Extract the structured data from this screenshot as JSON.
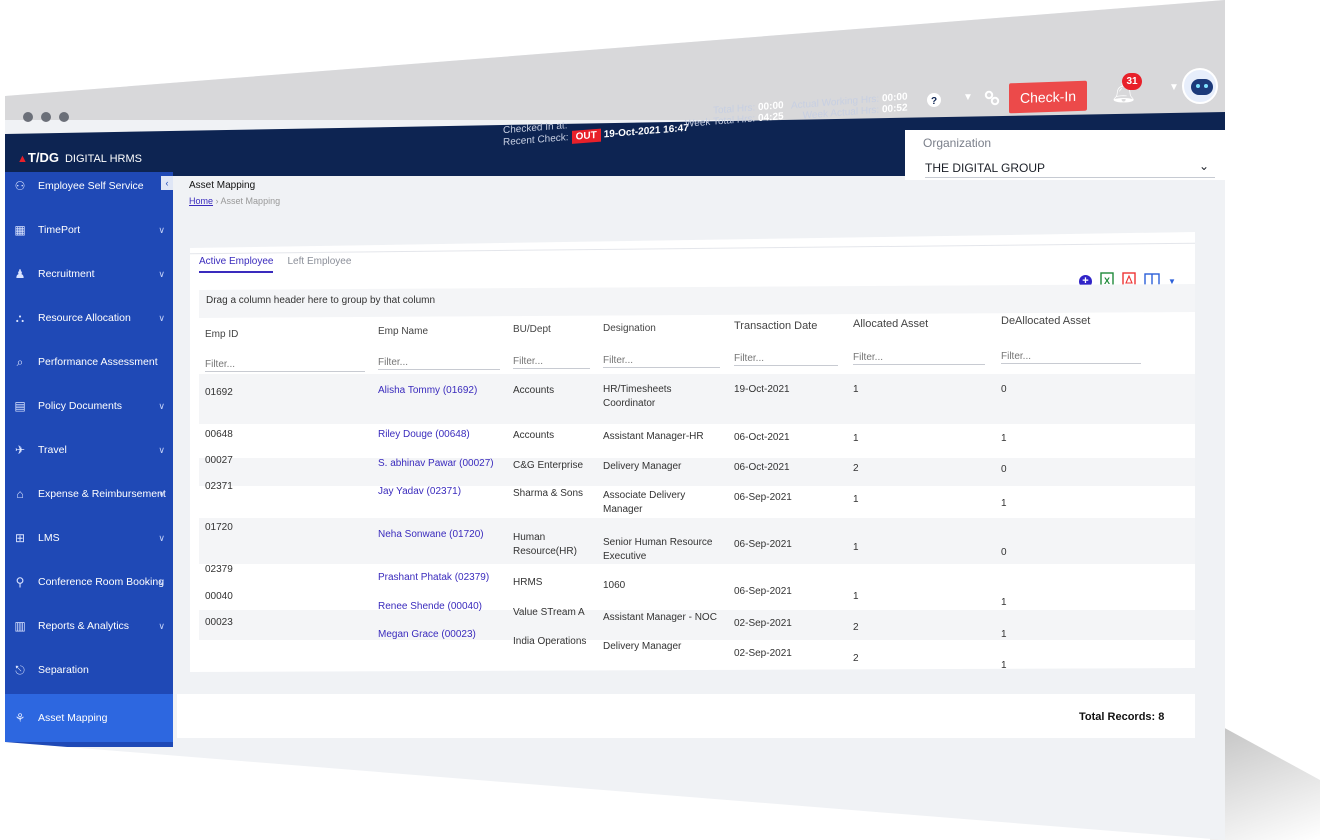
{
  "header": {
    "checked_in_label": "Checked In at:",
    "recent_check_label": "Recent Check:",
    "recent_status": "OUT",
    "recent_time": "19-Oct-2021 16:47",
    "total_hrs_label": "Total Hrs:",
    "total_hrs": "00:00",
    "week_total_label": "Week Total Hrs:",
    "week_total": "04:25",
    "actual_working_label": "Actual Working Hrs:",
    "actual_working": "00:00",
    "week_actual_label": "Week Actual Hrs:",
    "week_actual": "00:52",
    "checkin_label": "Check-In",
    "notification_count": "31"
  },
  "brand": {
    "logo": "T/DG",
    "name": "DIGITAL HRMS"
  },
  "organization": {
    "label": "Organization",
    "value": "THE DIGITAL GROUP"
  },
  "sidebar": {
    "items": [
      {
        "label": "Employee Self Service",
        "icon": "user-group-icon"
      },
      {
        "label": "TimePort",
        "icon": "calendar-icon"
      },
      {
        "label": "Recruitment",
        "icon": "people-icon"
      },
      {
        "label": "Resource Allocation",
        "icon": "network-icon"
      },
      {
        "label": "Performance Assessment",
        "icon": "magnifier-icon"
      },
      {
        "label": "Policy Documents",
        "icon": "document-icon"
      },
      {
        "label": "Travel",
        "icon": "plane-icon"
      },
      {
        "label": "Expense & Reimbursement",
        "icon": "receipt-icon"
      },
      {
        "label": "LMS",
        "icon": "book-icon"
      },
      {
        "label": "Conference Room Booking",
        "icon": "meeting-icon"
      },
      {
        "label": "Reports & Analytics",
        "icon": "chart-icon"
      },
      {
        "label": "Separation",
        "icon": "exit-icon"
      },
      {
        "label": "Asset Mapping",
        "icon": "asset-icon"
      }
    ]
  },
  "page": {
    "title": "Asset Mapping",
    "breadcrumb_home": "Home",
    "breadcrumb_sep": "›",
    "breadcrumb_current": "Asset Mapping"
  },
  "tabs": {
    "active": "Active Employee",
    "other": "Left Employee"
  },
  "grid": {
    "group_hint": "Drag a column header here to group by that column",
    "filter_placeholder": "Filter...",
    "columns": [
      "Emp ID",
      "Emp Name",
      "BU/Dept",
      "Designation",
      "Transaction Date",
      "Allocated Asset",
      "DeAllocated Asset"
    ],
    "rows": [
      {
        "id": "01692",
        "name": "Alisha Tommy (01692)",
        "dept": "Accounts",
        "designation": [
          "HR/Timesheets",
          "Coordinator"
        ],
        "date": "19-Oct-2021",
        "allocated": "1",
        "deallocated": "0"
      },
      {
        "id": "00648",
        "name": "Riley Douge (00648)",
        "dept": "Accounts",
        "designation": [
          "Assistant Manager-HR"
        ],
        "date": "06-Oct-2021",
        "allocated": "1",
        "deallocated": "1"
      },
      {
        "id": "00027",
        "name": "S. abhinav Pawar (00027)",
        "dept": "C&G Enterprise",
        "designation": [
          "Delivery Manager"
        ],
        "date": "06-Oct-2021",
        "allocated": "2",
        "deallocated": "0"
      },
      {
        "id": "02371",
        "name": "Jay Yadav (02371)",
        "dept": "Sharma & Sons",
        "designation": [
          "Associate Delivery",
          "Manager"
        ],
        "date": "06-Sep-2021",
        "allocated": "1",
        "deallocated": "1"
      },
      {
        "id": "01720",
        "name": "Neha Sonwane (01720)",
        "dept": "Human Resource(HR)",
        "designation": [
          "Senior Human Resource",
          "Executive"
        ],
        "date": "06-Sep-2021",
        "allocated": "1",
        "deallocated": "0"
      },
      {
        "id": "02379",
        "name": "Prashant Phatak (02379)",
        "dept": "HRMS",
        "designation": [
          "1060"
        ],
        "date": "06-Sep-2021",
        "allocated": "1",
        "deallocated": "1"
      },
      {
        "id": "00040",
        "name": "Renee Shende (00040)",
        "dept": "Value STream A",
        "designation": [
          "Assistant Manager - NOC"
        ],
        "date": "02-Sep-2021",
        "allocated": "2",
        "deallocated": "1"
      },
      {
        "id": "00023",
        "name": "Megan Grace (00023)",
        "dept": "India Operations",
        "designation": [
          "Delivery Manager"
        ],
        "date": "02-Sep-2021",
        "allocated": "2",
        "deallocated": "1"
      }
    ],
    "total_label": "Total Records: 8"
  }
}
